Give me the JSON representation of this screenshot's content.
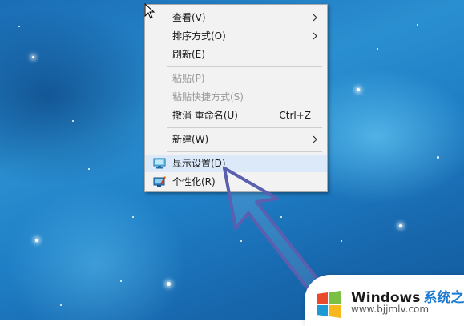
{
  "menu": {
    "items": [
      {
        "label": "查看(V)",
        "submenu": true
      },
      {
        "label": "排序方式(O)",
        "submenu": true
      },
      {
        "label": "刷新(E)"
      },
      {
        "label": "粘贴(P)",
        "disabled": true
      },
      {
        "label": "粘贴快捷方式(S)",
        "disabled": true
      },
      {
        "label": "撤消 重命名(U)",
        "shortcut": "Ctrl+Z"
      },
      {
        "label": "新建(W)",
        "submenu": true
      },
      {
        "label": "显示设置(D)",
        "icon": "display-icon",
        "highlighted": true
      },
      {
        "label": "个性化(R)",
        "icon": "personalize-icon"
      }
    ]
  },
  "watermark": {
    "brand": "Windows",
    "brand_cn": "系统之家",
    "url": "www.bjjmlv.com"
  },
  "colors": {
    "menu_bg": "#f2f2f2",
    "arrow": "#5a5fb0",
    "desktop": "#2a8fd0",
    "logo_red": "#e84a2b",
    "logo_green": "#7ac043",
    "logo_blue": "#1d9ad6",
    "logo_yellow": "#f6b81c"
  }
}
